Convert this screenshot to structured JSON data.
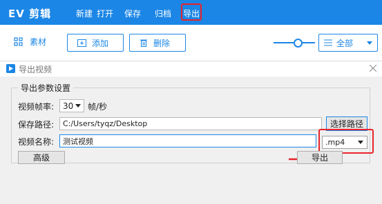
{
  "app": {
    "title": "EV 剪辑",
    "menu": [
      "新建",
      "打开",
      "保存",
      "归档",
      "导出"
    ]
  },
  "toolbar": {
    "material_tab": "素材",
    "add_label": "添加",
    "delete_label": "删除",
    "filter_value": "全部"
  },
  "dialog": {
    "title": "导出视频",
    "group_title": "导出参数设置",
    "fps_label": "视频帧率:",
    "fps_value": "30",
    "fps_unit": "帧/秒",
    "path_label": "保存路径:",
    "path_value": "C:/Users/tyqz/Desktop",
    "choose_path_label": "选择路径",
    "name_label": "视频名称:",
    "name_value": "测试视频",
    "format_value": ".mp4",
    "advanced_label": "高级",
    "export_label": "导出"
  },
  "colors": {
    "brand": "#1b86e6",
    "highlight": "#e8232a"
  }
}
